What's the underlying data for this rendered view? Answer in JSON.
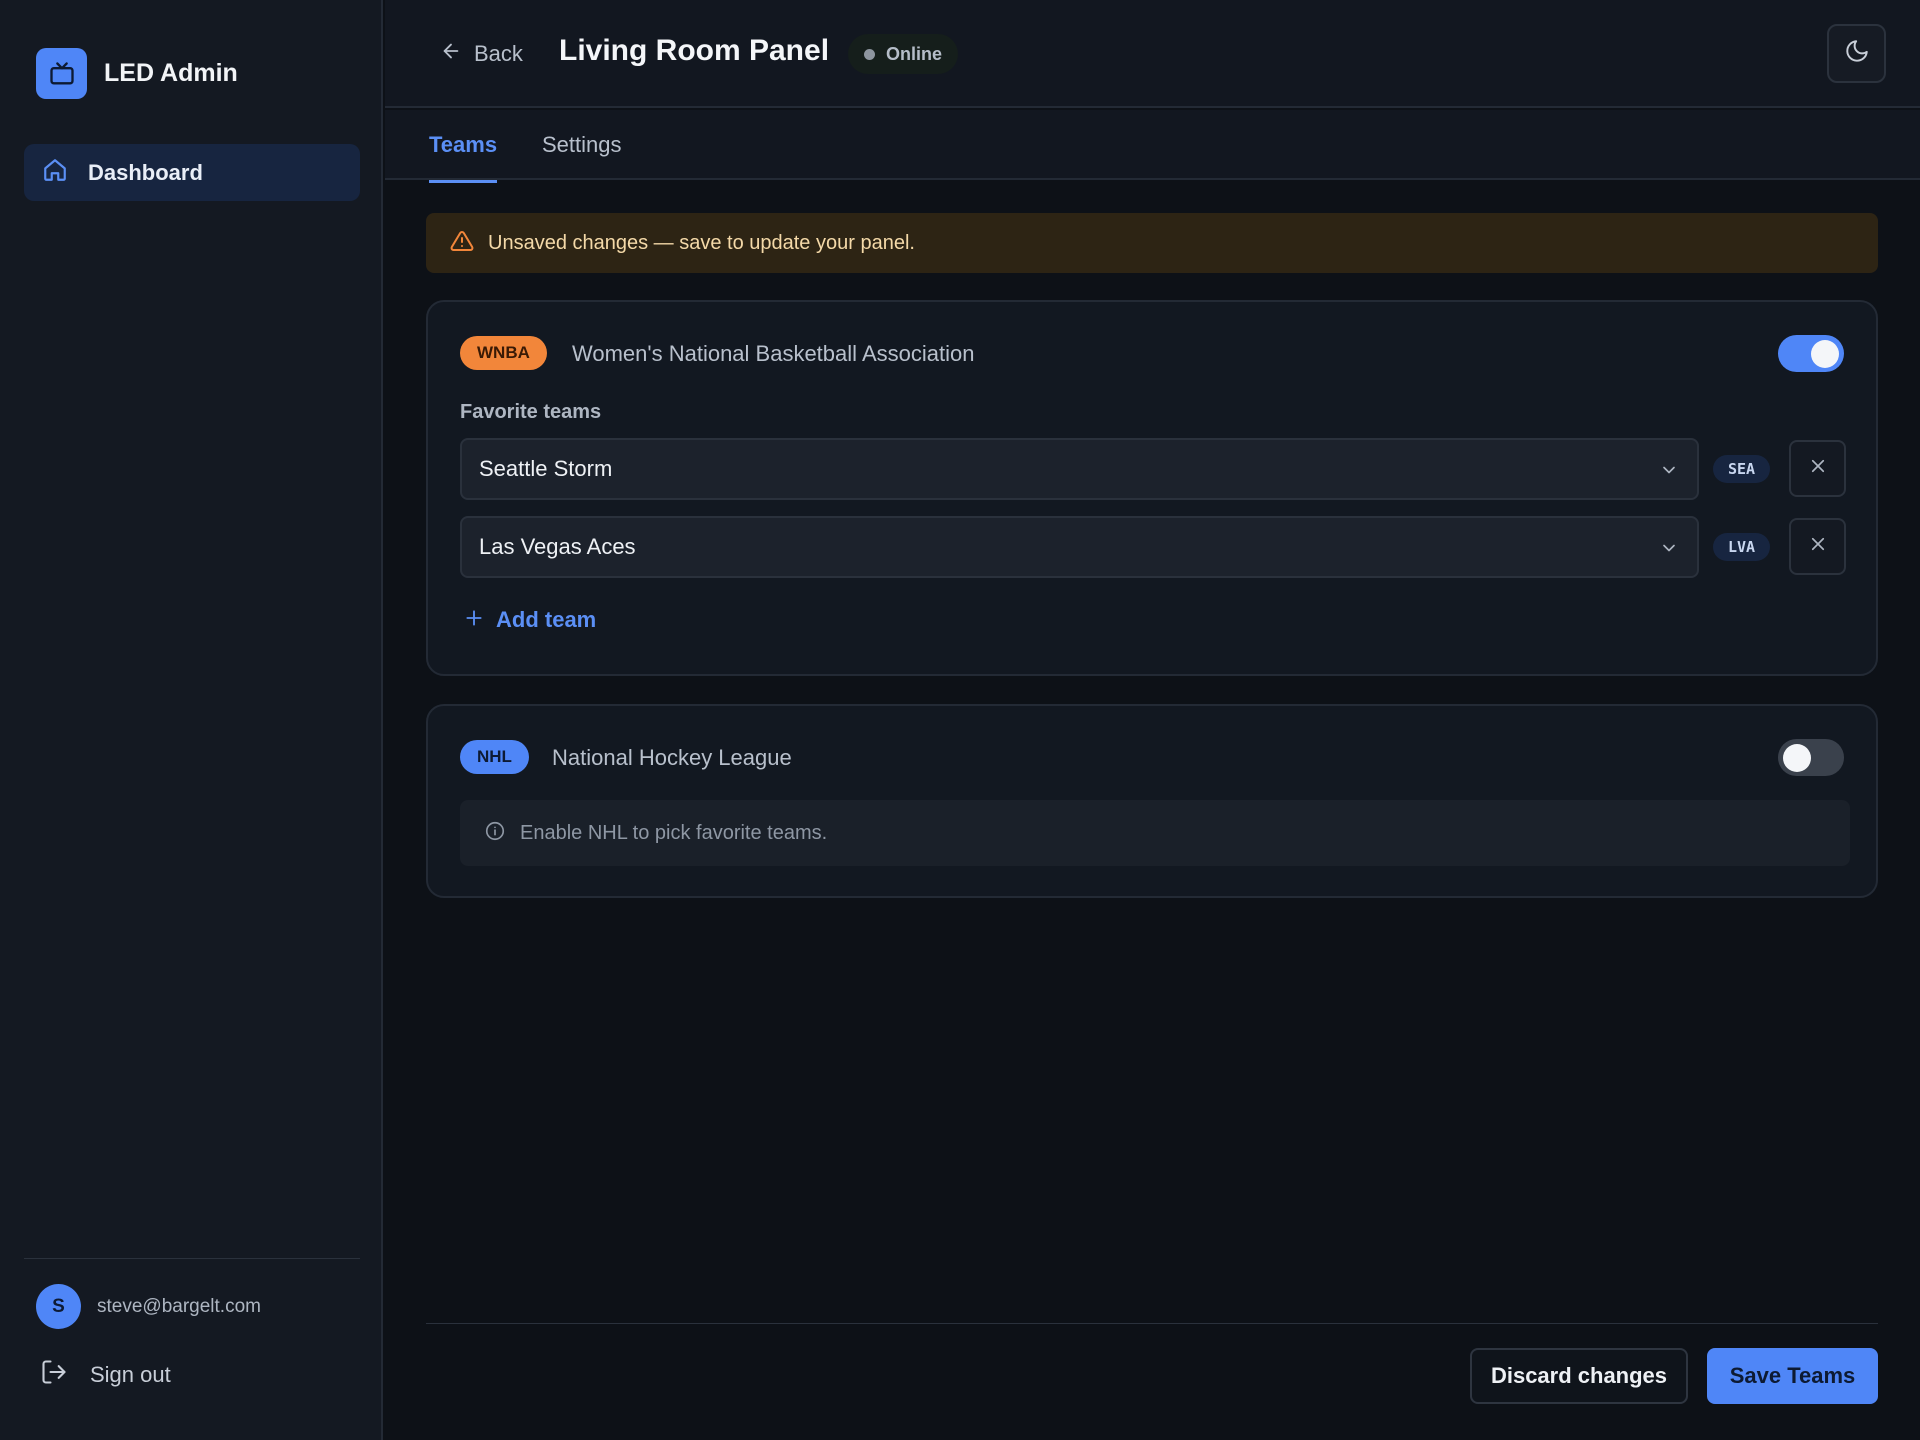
{
  "app": {
    "name": "LED Admin",
    "logo_icon": "tv-icon",
    "accent": "#4f86f7"
  },
  "sidebar": {
    "items": [
      {
        "label": "Dashboard",
        "icon": "home-icon",
        "active": true
      }
    ],
    "user": {
      "initial": "S",
      "email": "steve@bargelt.com"
    },
    "signout_label": "Sign out"
  },
  "header": {
    "back_label": "Back",
    "title": "Living Room Panel",
    "status": "Online",
    "theme_icon": "moon-icon"
  },
  "tabs": [
    {
      "label": "Teams",
      "active": true
    },
    {
      "label": "Settings",
      "active": false
    }
  ],
  "alert": {
    "text": "Unsaved changes — save to update your panel.",
    "icon": "warning-icon",
    "color": "#f2863a"
  },
  "leagues": [
    {
      "code": "WNBA",
      "name": "Women's National Basketball Association",
      "enabled": true,
      "badge_color": "#f2863a",
      "favorites_label": "Favorite teams",
      "teams": [
        {
          "name": "Seattle Storm",
          "abbr": "SEA"
        },
        {
          "name": "Las Vegas Aces",
          "abbr": "LVA"
        }
      ],
      "add_label": "Add team"
    },
    {
      "code": "NHL",
      "name": "National Hockey League",
      "enabled": false,
      "badge_color": "#4f86f7",
      "info": "Enable NHL to pick favorite teams."
    }
  ],
  "footer": {
    "discard_label": "Discard changes",
    "save_label": "Save Teams"
  }
}
